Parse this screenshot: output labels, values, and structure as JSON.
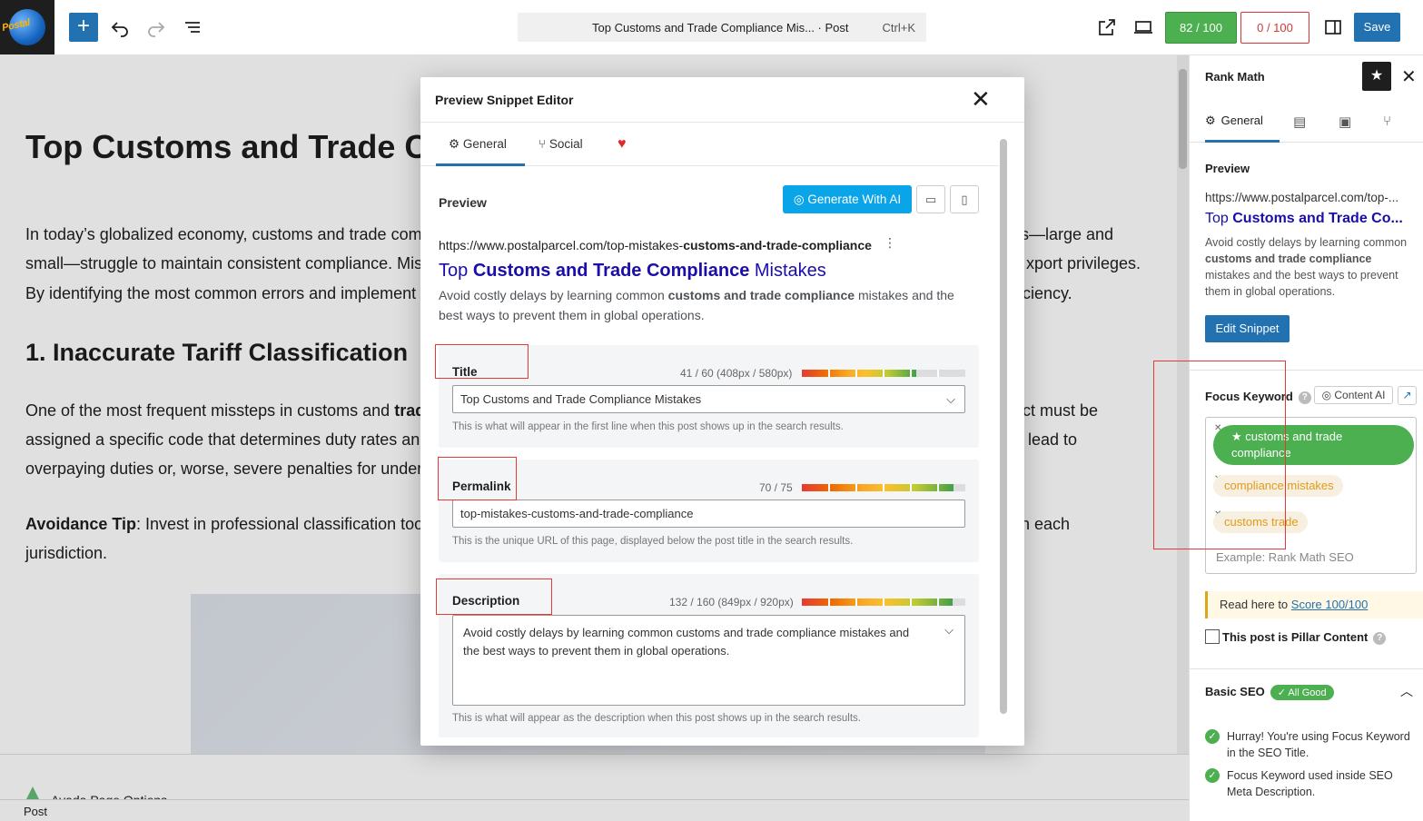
{
  "topbar": {
    "logo_text": "Postal",
    "command_title": "Top Customs and Trade Compliance Mis... · Post",
    "command_shortcut": "Ctrl+K",
    "seo_score": "82 / 100",
    "readability_score": "0 / 100",
    "save_label": "Save",
    "icons": [
      "plus-icon",
      "undo-icon",
      "redo-icon",
      "list-view-icon",
      "external-link-icon",
      "desktop-preview-icon",
      "sidebar-toggle-icon"
    ]
  },
  "editor": {
    "title": "Top Customs and Trade Co",
    "para1_line1": "In today’s globalized economy, customs and trade com",
    "para1_line1_right": "s—large and",
    "para1_line2": "small—struggle to maintain consistent compliance. Mis",
    "para1_line2_right": "xport privileges.",
    "para1_line3": "By identifying the most common errors and implement",
    "para1_line3_right": "ficiency.",
    "heading1": "1. Inaccurate Tariff Classification",
    "para2_line1_a": "One of the most frequent missteps in customs and ",
    "para2_line1_b": "trad",
    "para2_line1_right": "ct must be",
    "para2_line2": "assigned a specific code that determines duty rates and",
    "para2_line2_right": "lead to",
    "para2_line3": "overpaying duties or, worse, severe penalties for under",
    "tip_label": "Avoidance Tip",
    "tip_text": ": Invest in professional classification tools",
    "tip_right": "n each",
    "tip_line2": "jurisdiction."
  },
  "bottom": {
    "avada_label": "Avada Page Options",
    "status": "Post"
  },
  "modal": {
    "title": "Preview Snippet Editor",
    "tabs": [
      {
        "label": "General",
        "icon": "gear-icon"
      },
      {
        "label": "Social",
        "icon": "share-icon"
      },
      {
        "label": "",
        "icon": "heart-icon"
      }
    ],
    "preview_label": "Preview",
    "generate_ai_label": "Generate With AI",
    "serp": {
      "url_prefix": "https://www.postalparcel.com/top-mistakes-",
      "url_bold": "customs-and-trade-compliance",
      "title_a": "Top ",
      "title_b": "Customs and Trade Compliance",
      "title_c": " Mistakes",
      "desc_a": "Avoid costly delays by learning common ",
      "desc_b": "customs and trade compliance",
      "desc_c": " mistakes and the best ways to prevent them in global operations."
    },
    "fields": {
      "title": {
        "label": "Title",
        "count": "41 / 60 (408px / 580px)",
        "progress": 0.7,
        "value": "Top Customs and Trade Compliance Mistakes",
        "help": "This is what will appear in the first line when this post shows up in the search results."
      },
      "permalink": {
        "label": "Permalink",
        "count": "70 / 75",
        "progress": 0.93,
        "value": "top-mistakes-customs-and-trade-compliance",
        "help": "This is the unique URL of this page, displayed below the post title in the search results."
      },
      "description": {
        "label": "Description",
        "count": "132 / 160 (849px / 920px)",
        "progress": 0.92,
        "value": "Avoid costly delays by learning common customs and trade compliance mistakes and the best ways to prevent them in global operations.",
        "help": "This is what will appear as the description when this post shows up in the search results."
      }
    }
  },
  "sidebar": {
    "title": "Rank Math",
    "tab_general": "General",
    "preview_label": "Preview",
    "url": "https://www.postalparcel.com/top-...",
    "serp_title_a": "Top ",
    "serp_title_b": "Customs and Trade Co...",
    "serp_desc_a": "Avoid costly delays by learning common ",
    "serp_desc_b": "customs and trade compliance",
    "serp_desc_c": " mistakes and the best ways to prevent them in global operations.",
    "edit_snippet_label": "Edit Snippet",
    "focus_keyword_label": "Focus Keyword",
    "content_ai_label": "Content AI",
    "keywords": [
      "customs and trade compliance",
      "compliance mistakes",
      "customs trade"
    ],
    "keyword_placeholder": "Example: Rank Math SEO",
    "read_here_prefix": "Read here to ",
    "read_here_link": "Score 100/100",
    "pillar_label": "This post is Pillar Content",
    "basic_seo_label": "Basic SEO",
    "all_good_label": "✓ All Good",
    "checks": [
      "Hurray! You're using Focus Keyword in the SEO Title.",
      "Focus Keyword used inside SEO Meta Description."
    ]
  }
}
